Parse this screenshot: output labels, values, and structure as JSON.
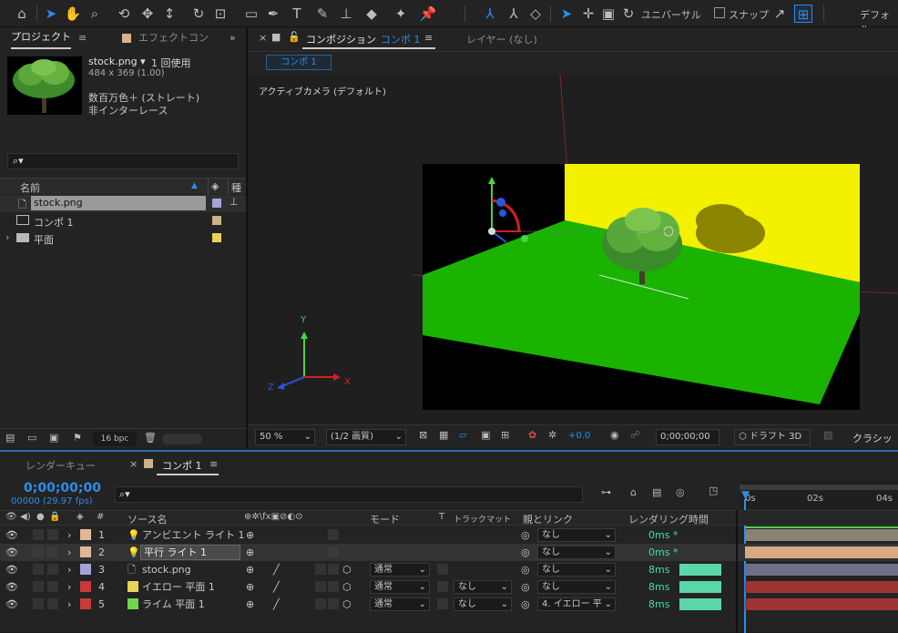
{
  "toolbar": {
    "universal": "ユニバーサル",
    "snap": "スナップ",
    "workspace": "デフォル"
  },
  "project": {
    "tab_project": "プロジェクト",
    "tab_effects": "エフェクトコン",
    "file_name": "stock.png ▾",
    "usage": "1 回使用",
    "dims": "484 x 369 (1.00)",
    "color_desc": "数百万色＋ (ストレート)",
    "interlace": "非インターレース",
    "search_icon": "⌕▾",
    "col_name": "名前",
    "col_type": "種",
    "items": [
      {
        "name": "stock.png",
        "color": "#a3a3d6",
        "icon": "file-icon"
      },
      {
        "name": "コンポ 1",
        "color": "#c7b486",
        "icon": "comp-icon"
      },
      {
        "name": "平面",
        "color": "#e6d35a",
        "icon": "folder-icon"
      }
    ],
    "bpc": "16 bpc"
  },
  "comp": {
    "tab_label": "コンポジション",
    "tab_name": "コンポ 1",
    "layer_tab": "レイヤー (なし)",
    "sub_tab": "コンポ 1",
    "camera_label": "アクティブカメラ (デフォルト)",
    "zoom": "50 %",
    "resolution": "(1/2 画質)",
    "exposure": "+0.0",
    "timecode": "0;00;00;00",
    "draft": "ドラフト 3D",
    "renderer": "クラシッ"
  },
  "timeline": {
    "tab_render": "レンダーキュー",
    "tab_comp": "コンポ 1",
    "timecode": "0;00;00;00",
    "frames": "00000 (29.97 fps)",
    "search_icon": "⌕▾",
    "col_source": "ソース名",
    "col_mode": "モード",
    "col_t": "T",
    "col_matte": "トラックマット",
    "col_parent": "親とリンク",
    "col_render": "レンダリング時間",
    "ruler": [
      "0s",
      "02s",
      "04s"
    ],
    "layers": [
      {
        "num": "1",
        "name": "アンビエント ライト 1",
        "label": "#e2b894",
        "icon": "light-icon",
        "mode": "",
        "matte": "",
        "parent": "なし",
        "render": "0ms *",
        "bar": "#8a8272",
        "selected": false
      },
      {
        "num": "2",
        "name": "平行 ライト 1",
        "label": "#e2b894",
        "icon": "light-icon",
        "mode": "",
        "matte": "",
        "parent": "なし",
        "render": "0ms *",
        "bar": "#d9a982",
        "selected": true
      },
      {
        "num": "3",
        "name": "stock.png",
        "label": "#a3a3d6",
        "icon": "file-icon",
        "mode": "通常",
        "matte": "",
        "parent": "なし",
        "render": "8ms",
        "bar": "#6e6e88",
        "selected": false
      },
      {
        "num": "4",
        "name": "イエロー 平面 1",
        "label": "#e6d35a",
        "icon": "solid-icon",
        "mode": "通常",
        "matte": "なし",
        "parent": "なし",
        "render": "8ms",
        "bar": "#9e3434",
        "selected": false
      },
      {
        "num": "5",
        "name": "ライム 平面 1",
        "label": "#6fd64a",
        "icon": "solid-icon",
        "mode": "通常",
        "matte": "なし",
        "parent": "4. イエロー 平",
        "render": "8ms",
        "bar": "#9e3434",
        "selected": false
      }
    ]
  },
  "axis": {
    "x": "X",
    "y": "Y",
    "z": "Z"
  },
  "colors": {
    "accent": "#2d8ceb",
    "render_green": "#3ee0a0",
    "render_bar": "#5ad6a8"
  }
}
